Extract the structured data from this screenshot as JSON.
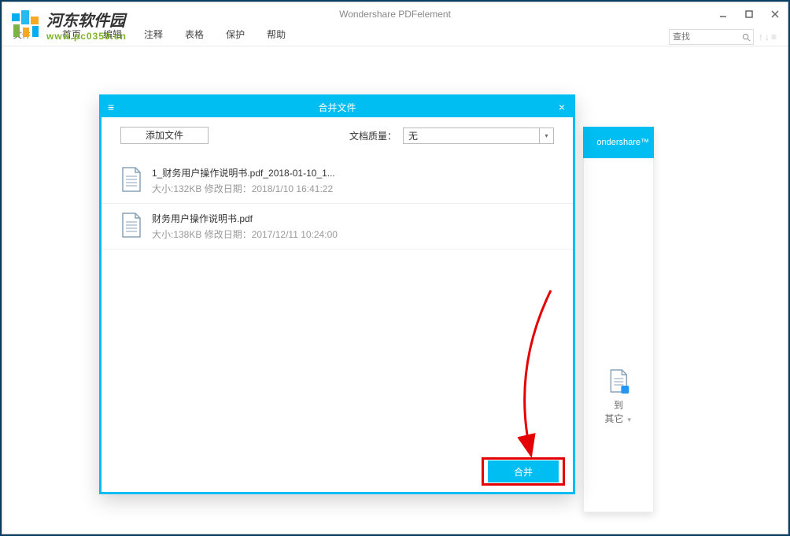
{
  "window": {
    "title": "Wondershare PDFelement"
  },
  "watermark": {
    "title": "河东软件园",
    "url": "www.pc0359.cn"
  },
  "menu": {
    "items": [
      "首页",
      "编辑",
      "注释",
      "表格",
      "保护",
      "帮助"
    ],
    "file_tab": "文件",
    "search_placeholder": "查找"
  },
  "brand": {
    "text": "ondershare™"
  },
  "rightpanel": {
    "item_label_1": "到",
    "item_label_2": "其它"
  },
  "dialog": {
    "title": "合并文件",
    "add_file": "添加文件",
    "quality_label": "文档质量：",
    "quality_value": "无",
    "files": [
      {
        "name": "1_财务用户操作说明书.pdf_2018-01-10_1...",
        "meta": "大小:132KB 修改日期：2018/1/10 16:41:22"
      },
      {
        "name": "财务用户操作说明书.pdf",
        "meta": "大小:138KB 修改日期：2017/12/11 10:24:00"
      }
    ],
    "merge_button": "合并"
  }
}
